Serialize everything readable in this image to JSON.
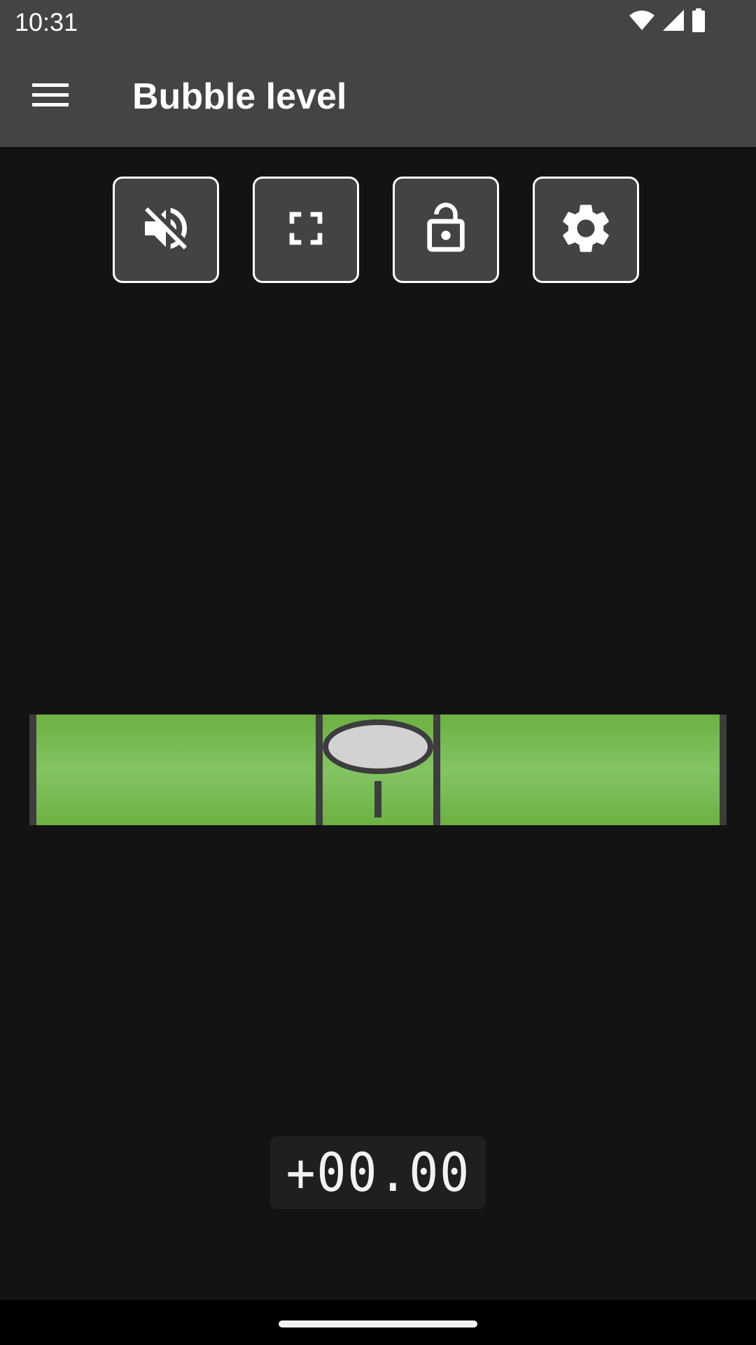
{
  "status_bar": {
    "time": "10:31",
    "icons": [
      "wifi-icon",
      "signal-icon",
      "battery-icon"
    ]
  },
  "app_bar": {
    "title": "Bubble level",
    "menu_icon": "menu-icon"
  },
  "toolbar": {
    "buttons": [
      {
        "icon": "volume-off-icon",
        "state": "sound muted"
      },
      {
        "icon": "fullscreen-icon"
      },
      {
        "icon": "lock-open-icon",
        "state": "unlocked"
      },
      {
        "icon": "settings-icon"
      }
    ]
  },
  "level": {
    "tilt_degrees": 0.0,
    "tube_color": "#6cb142",
    "tube_highlight_color": "#83c463",
    "bubble_color": "#d2d2d2",
    "frame_color": "#3d3d3d"
  },
  "readout": {
    "value": "+00.00"
  },
  "colors": {
    "background": "#131313",
    "bars": "#444444",
    "button_border": "#ffffff"
  }
}
